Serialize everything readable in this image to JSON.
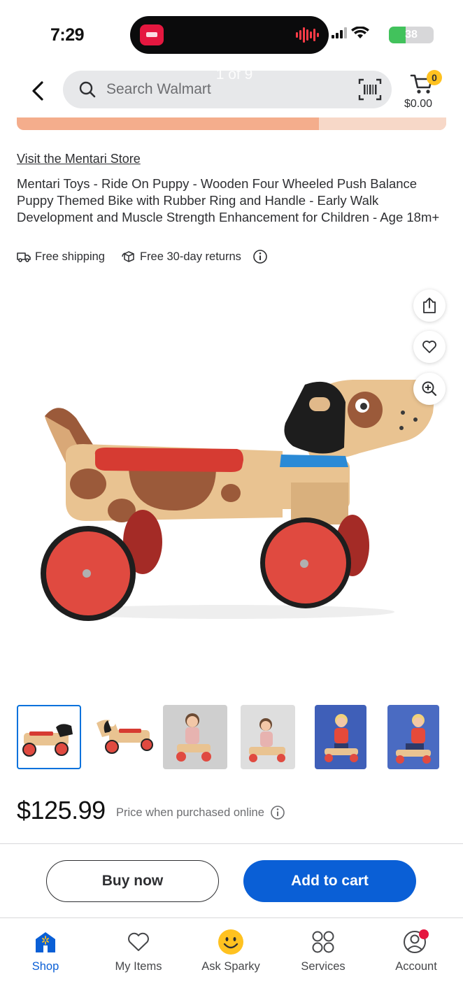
{
  "status_bar": {
    "time": "7:29",
    "battery": "38",
    "battery_level": 0.38
  },
  "header": {
    "back_icon": "chevron-left-icon",
    "search_placeholder": "Search Walmart",
    "image_counter": "1 of 9",
    "cart_count": "0",
    "cart_total": "$0.00"
  },
  "product": {
    "store_link": "Visit the Mentari Store",
    "title": "Mentari Toys - Ride On Puppy - Wooden Four Wheeled Push Balance Puppy Themed Bike with Rubber Ring and Handle - Early Walk Development and Muscle Strength Enhancement for Children - Age 18m+",
    "perks": {
      "shipping": "Free shipping",
      "returns": "Free 30-day returns"
    },
    "price": "$125.99",
    "price_note": "Price when purchased online",
    "thumbnail_count": 6,
    "selected_thumbnail": 1
  },
  "actions": {
    "buy_now": "Buy now",
    "add_to_cart": "Add to cart"
  },
  "bottom_nav": {
    "items": [
      {
        "label": "Shop",
        "icon": "shop-icon",
        "active": true
      },
      {
        "label": "My Items",
        "icon": "heart-icon"
      },
      {
        "label": "Ask Sparky",
        "icon": "sparky-icon"
      },
      {
        "label": "Services",
        "icon": "services-grid-icon"
      },
      {
        "label": "Account",
        "icon": "account-icon",
        "badge": true
      }
    ]
  },
  "colors": {
    "brand_blue": "#0a5fd6",
    "cart_badge": "#ffc220",
    "notification": "#e5173f"
  }
}
